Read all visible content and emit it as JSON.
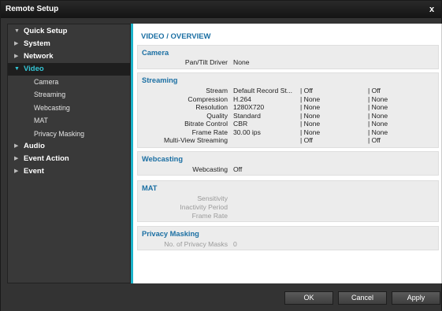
{
  "window": {
    "title": "Remote Setup",
    "close_glyph": "x"
  },
  "sidebar": {
    "items": [
      {
        "label": "Quick Setup"
      },
      {
        "label": "System"
      },
      {
        "label": "Network"
      },
      {
        "label": "Video",
        "expanded": true,
        "selected": true,
        "children": [
          "Camera",
          "Streaming",
          "Webcasting",
          "MAT",
          "Privacy Masking"
        ]
      },
      {
        "label": "Audio"
      },
      {
        "label": "Event Action"
      },
      {
        "label": "Event"
      }
    ]
  },
  "page": {
    "title": "VIDEO / OVERVIEW"
  },
  "camera": {
    "title": "Camera",
    "pan_tilt_label": "Pan/Tilt Driver",
    "pan_tilt_value": "None"
  },
  "streaming": {
    "title": "Streaming",
    "rows": [
      {
        "label": "Stream",
        "v1": "Default Record St...",
        "v2": "| Off",
        "v3": "| Off"
      },
      {
        "label": "Compression",
        "v1": "H.264",
        "v2": "| None",
        "v3": "| None"
      },
      {
        "label": "Resolution",
        "v1": "1280X720",
        "v2": "| None",
        "v3": "| None"
      },
      {
        "label": "Quality",
        "v1": "Standard",
        "v2": "| None",
        "v3": "| None"
      },
      {
        "label": "Bitrate Control",
        "v1": "CBR",
        "v2": "| None",
        "v3": "| None"
      },
      {
        "label": "Frame Rate",
        "v1": "30.00 ips",
        "v2": "| None",
        "v3": "| None"
      },
      {
        "label": "Multi-View Streaming",
        "v1": "",
        "v2": "| Off",
        "v3": "| Off"
      }
    ]
  },
  "webcasting": {
    "title": "Webcasting",
    "label": "Webcasting",
    "value": "Off"
  },
  "mat": {
    "title": "MAT",
    "labels": [
      "Sensitivity",
      "Inactivity Period",
      "Frame Rate"
    ]
  },
  "privacy": {
    "title": "Privacy Masking",
    "label": "No. of Privacy Masks",
    "value": "0"
  },
  "buttons": {
    "ok": "OK",
    "cancel": "Cancel",
    "apply": "Apply"
  },
  "colors": {
    "accent": "#1bb2c9",
    "section_title": "#1b6fa3",
    "selected_nav": "#34c6d6"
  },
  "icons": {
    "expanded": "triangle-down-icon",
    "collapsed": "triangle-right-icon"
  }
}
